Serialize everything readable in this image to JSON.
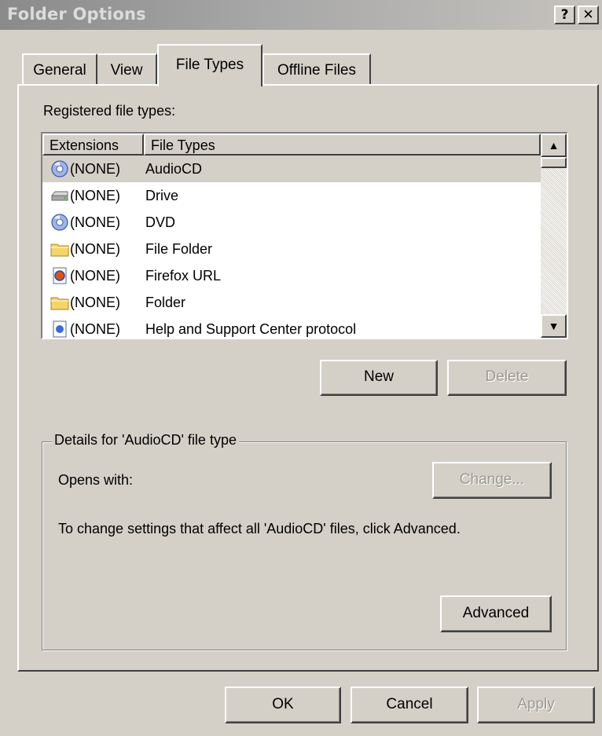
{
  "window": {
    "title": "Folder Options",
    "help_label": "?",
    "close_label": "✕"
  },
  "tabs": [
    {
      "label": "General",
      "selected": false
    },
    {
      "label": "View",
      "selected": false
    },
    {
      "label": "File Types",
      "selected": true
    },
    {
      "label": "Offline Files",
      "selected": false
    }
  ],
  "registered_label": "Registered file types:",
  "list": {
    "columns": [
      "Extensions",
      "File Types"
    ],
    "rows": [
      {
        "ext": "(NONE)",
        "type": "AudioCD",
        "icon": "cd-icon",
        "selected": true
      },
      {
        "ext": "(NONE)",
        "type": "Drive",
        "icon": "drive-icon",
        "selected": false
      },
      {
        "ext": "(NONE)",
        "type": "DVD",
        "icon": "cd-icon",
        "selected": false
      },
      {
        "ext": "(NONE)",
        "type": "File Folder",
        "icon": "folder-icon",
        "selected": false
      },
      {
        "ext": "(NONE)",
        "type": "Firefox URL",
        "icon": "firefox-url-icon",
        "selected": false
      },
      {
        "ext": "(NONE)",
        "type": "Folder",
        "icon": "folder-icon",
        "selected": false
      },
      {
        "ext": "(NONE)",
        "type": "Help and Support Center protocol",
        "icon": "help-protocol-icon",
        "selected": false
      }
    ],
    "scroll_up": "▲",
    "scroll_down": "▼"
  },
  "buttons": {
    "new": "New",
    "delete": "Delete",
    "change": "Change...",
    "advanced": "Advanced",
    "ok": "OK",
    "cancel": "Cancel",
    "apply": "Apply"
  },
  "details": {
    "title": "Details for 'AudioCD' file type",
    "opens_with_label": "Opens with:",
    "hint": "To change settings that affect all 'AudioCD' files, click Advanced."
  }
}
